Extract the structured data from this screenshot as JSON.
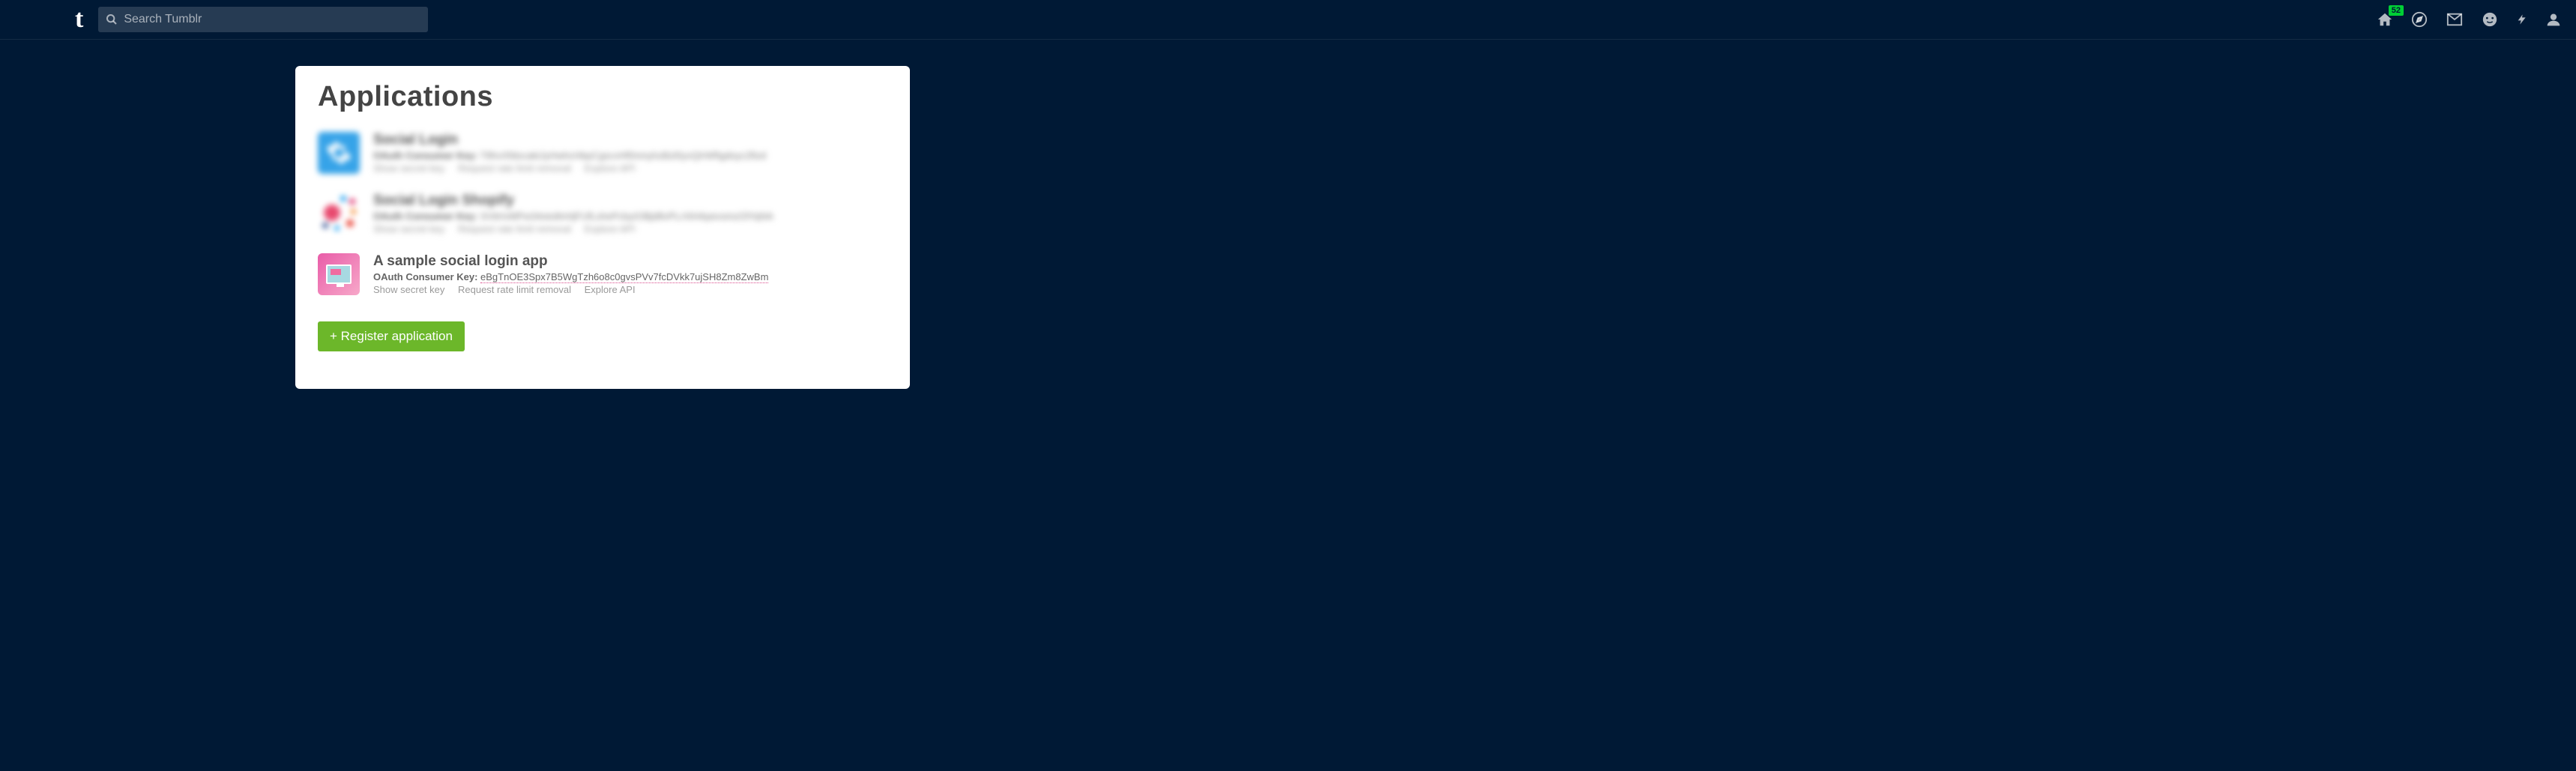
{
  "header": {
    "search_placeholder": "Search Tumblr",
    "badge": "52"
  },
  "page": {
    "title": "Applications"
  },
  "apps": [
    {
      "name": "Social Login",
      "key_label": "OAuth Consumer Key:",
      "key_value": "T8hvXfdocaktJyHwhcHbpCgscvHf0nmyhzBzl0yvQIrWfIgdoyc2fizd",
      "link1": "Show secret key",
      "link2": "Request rate limit removal",
      "link3": "Explore API"
    },
    {
      "name": "Social Login Shopify",
      "key_label": "OAuth Consumer Key:",
      "key_value": "SVitrIvMPw34oto8nHjFUfLshePcbyIOBjd8vPLrXiHApevsmzOlYqNA",
      "link1": "Show secret key",
      "link2": "Request rate limit removal",
      "link3": "Explore API"
    },
    {
      "name": "A sample social login app",
      "key_label": "OAuth Consumer Key:",
      "key_value": "eBgTnOE3Spx7B5WgTzh6o8c0gvsPVv7fcDVkk7ujSH8Zm8ZwBm",
      "link1": "Show secret key",
      "link2": "Request rate limit removal",
      "link3": "Explore API"
    }
  ],
  "buttons": {
    "register": "+ Register application"
  }
}
